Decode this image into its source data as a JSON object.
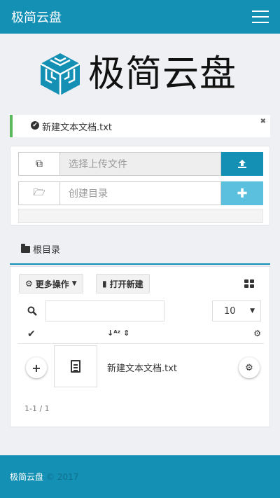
{
  "app": {
    "title": "极简云盘",
    "logo_text": "极简云盘"
  },
  "colors": {
    "primary": "#1590b5",
    "info": "#5bc0de",
    "success": "#5cb85c"
  },
  "alert": {
    "message": "新建文本文档.txt",
    "icon": "check-circle-icon",
    "close_icon": "close-icon"
  },
  "upload": {
    "file_placeholder": "选择上传文件",
    "dir_placeholder": "创建目录",
    "upload_icon": "upload-icon",
    "create_icon": "plus-icon"
  },
  "tab": {
    "label": "根目录",
    "icon": "folder-icon"
  },
  "toolbar": {
    "more_label": "更多操作",
    "more_icon": "cog-icon",
    "second_label": "打开新建",
    "view_icon": "grid-icon"
  },
  "search": {
    "placeholder": "",
    "page_size": "10"
  },
  "table": {
    "sort_icon": "sort-alpha-icon",
    "settings_icon": "cogs-icon"
  },
  "files": [
    {
      "name": "新建文本文档.txt",
      "icon": "document-icon"
    }
  ],
  "pagination": {
    "text": "1-1 / 1"
  },
  "footer": {
    "brand": "极简云盘",
    "year": "© 2017"
  }
}
